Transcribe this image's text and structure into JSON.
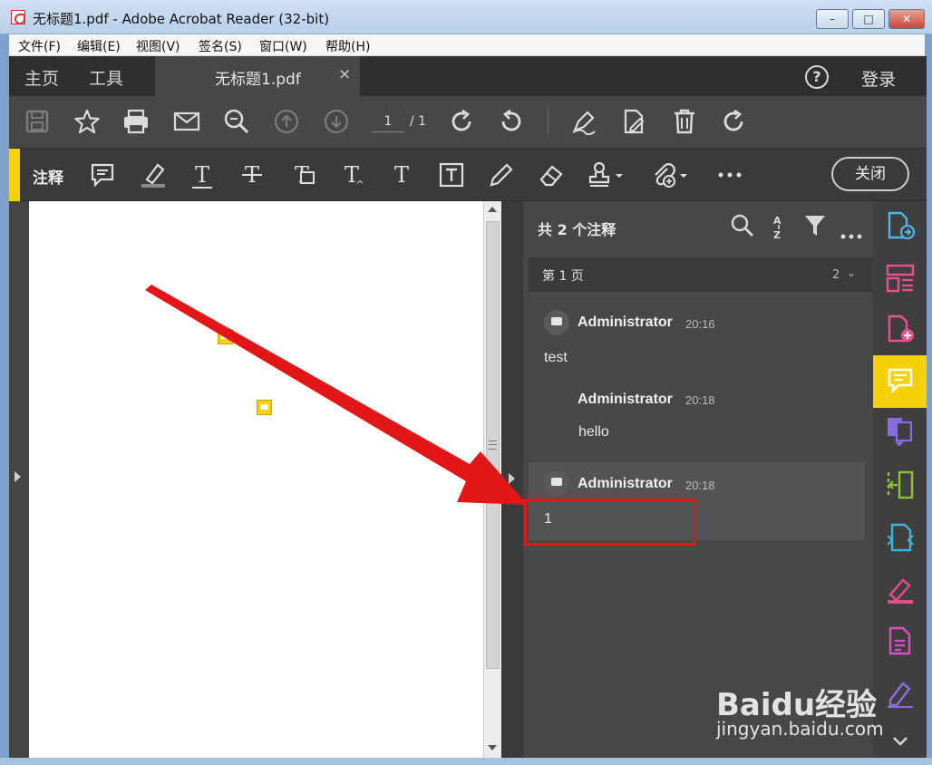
{
  "window": {
    "title": "无标题1.pdf - Adobe Acrobat Reader (32-bit)",
    "min_label": "–",
    "max_label": "□",
    "close_label": "✕"
  },
  "menu": [
    "文件(F)",
    "编辑(E)",
    "视图(V)",
    "签名(S)",
    "窗口(W)",
    "帮助(H)"
  ],
  "tabs": {
    "home": "主页",
    "tools": "工具",
    "document": "无标题1.pdf",
    "close": "×",
    "help": "?",
    "login": "登录"
  },
  "toolbar": {
    "icons": [
      "save-icon",
      "star-icon",
      "print-icon",
      "email-icon",
      "zoom-icon",
      "page-up-icon",
      "page-down-icon",
      "rotate-cw-icon",
      "rotate-ccw-icon",
      "sign-icon",
      "edit-pdf-icon",
      "delete-icon",
      "redo-icon"
    ],
    "page_current": "1",
    "page_total": "/ 1"
  },
  "comment_bar": {
    "label": "注释",
    "close_label": "关闭",
    "icons": [
      "sticky-note-icon",
      "highlight-icon",
      "underline-text-icon",
      "strikethrough-icon",
      "replace-text-icon",
      "insert-text-icon",
      "add-text-icon",
      "text-box-icon",
      "pencil-icon",
      "eraser-icon",
      "stamp-icon",
      "attach-icon",
      "more-icon"
    ]
  },
  "pane": {
    "count_label": "共 2 个注释",
    "page_group": "第 1 页",
    "page_group_count": "2",
    "threads": [
      {
        "author": "Administrator",
        "time": "20:16",
        "text": "test",
        "replies": [
          {
            "author": "Administrator",
            "time": "20:18",
            "text": "hello"
          }
        ]
      },
      {
        "author": "Administrator",
        "time": "20:18",
        "text": "1"
      }
    ]
  },
  "rail": {
    "icons": [
      "export-pdf-icon",
      "organize-pages-icon",
      "create-pdf-icon",
      "comment-icon",
      "combine-files-icon",
      "compress-icon",
      "send-icon",
      "fill-sign-icon",
      "scan-icon",
      "sign-pen-icon"
    ],
    "colors": [
      "#4fb4e6",
      "#e8508e",
      "#e8508e",
      "#f5d10a",
      "#8a6ce0",
      "#8ac23a",
      "#3cb3d8",
      "#e84c8a",
      "#d64fc8",
      "#8a6ce0"
    ]
  },
  "watermark": {
    "brand": "Baidu经验",
    "url": "jingyan.baidu.com"
  },
  "colors": {
    "accent": "#f5d10a",
    "highlight_box": "#e21616",
    "arrow": "#e21616"
  }
}
